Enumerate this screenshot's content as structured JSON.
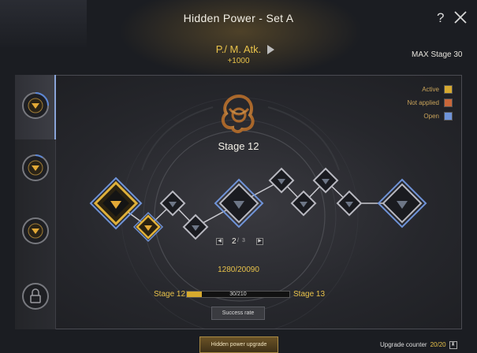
{
  "window": {
    "title": "Hidden Power - Set A",
    "help_label": "?"
  },
  "attribute": {
    "name": "P./ M. Atk.",
    "value": "+1000"
  },
  "max_stage": "MAX Stage 30",
  "background_text": [
    "",
    ""
  ],
  "legend": [
    {
      "label": "Active",
      "color": "#d6a930"
    },
    {
      "label": "Not applied",
      "color": "#c9673a"
    },
    {
      "label": "Open",
      "color": "#6f93d8"
    }
  ],
  "stage_title": "Stage 12",
  "pager": {
    "current": "2",
    "separator": "/",
    "total": "3"
  },
  "experience": "1280/20090",
  "progress": {
    "from": "Stage 12",
    "to": "Stage 13",
    "text": "30/210",
    "fraction": 0.143
  },
  "success_rate_label": "Success rate",
  "upgrade_button_label": "Hidden power upgrade",
  "upgrade_counter": {
    "label": "Upgrade counter",
    "value": "20/20"
  },
  "icons": {
    "close": "close-icon",
    "arrow": "triangle-right-icon",
    "lock": "lock-icon",
    "node": "triangle-node-icon",
    "emblem": "celtic-knot-emblem-icon"
  }
}
